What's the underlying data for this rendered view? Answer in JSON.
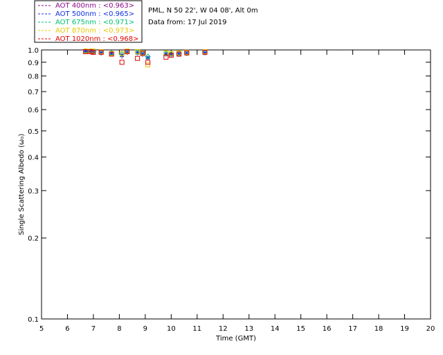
{
  "header": {
    "site": "PML, N 50 22', W 04 08', Alt 0m",
    "date": "Data from: 17 Jul 2019"
  },
  "chart_data": {
    "type": "scatter",
    "title": "",
    "xlabel": "Time (GMT)",
    "ylabel": "Single Scattering Albedo (ω₀)",
    "xlim": [
      5,
      20
    ],
    "ylim": [
      0.1,
      1.0
    ],
    "yscale": "log",
    "x_ticks": [
      5,
      6,
      7,
      8,
      9,
      10,
      11,
      12,
      13,
      14,
      15,
      16,
      17,
      18,
      19,
      20
    ],
    "y_ticks": [
      0.1,
      0.2,
      0.3,
      0.4,
      0.5,
      0.6,
      0.7,
      0.8,
      0.9,
      1.0
    ],
    "y_tick_labels": [
      "0.1",
      "0.2",
      "0.3",
      "0.4",
      "0.5",
      "0.6",
      "0.7",
      "0.8",
      "0.9",
      "1.0"
    ],
    "grid": false,
    "legend_position": "top-left",
    "series": [
      {
        "name": "AOT  400nm : <0.963>",
        "color": "#8b0a8b",
        "marker": "plus",
        "x": [
          6.7,
          6.9,
          7.0,
          7.3,
          7.7,
          8.1,
          8.3,
          8.7,
          8.9,
          9.1,
          9.8,
          10.0,
          10.3,
          10.6,
          11.3
        ],
        "y": [
          0.985,
          0.98,
          0.975,
          0.97,
          0.965,
          0.945,
          0.975,
          0.97,
          0.96,
          0.93,
          0.96,
          0.955,
          0.96,
          0.965,
          0.97
        ]
      },
      {
        "name": "AOT  500nm : <0.965>",
        "color": "#1030e0",
        "marker": "asterisk",
        "x": [
          6.7,
          6.9,
          7.0,
          7.3,
          7.7,
          8.1,
          8.3,
          8.7,
          8.9,
          9.1,
          9.8,
          10.0,
          10.3,
          10.6,
          11.3
        ],
        "y": [
          0.99,
          0.985,
          0.98,
          0.975,
          0.97,
          0.955,
          0.98,
          0.975,
          0.965,
          0.935,
          0.965,
          0.96,
          0.965,
          0.97,
          0.975
        ]
      },
      {
        "name": "AOT  675nm : <0.971>",
        "color": "#00c070",
        "marker": "diamond",
        "x": [
          6.7,
          6.9,
          7.0,
          7.3,
          7.7,
          8.1,
          8.3,
          8.7,
          8.9,
          9.1,
          9.8,
          10.0,
          10.3,
          10.6,
          11.3
        ],
        "y": [
          0.99,
          0.99,
          0.985,
          0.98,
          0.975,
          0.965,
          0.985,
          0.98,
          0.97,
          0.945,
          0.97,
          0.965,
          0.97,
          0.975,
          0.98
        ]
      },
      {
        "name": "AOT  870nm : <0.973>",
        "color": "#e8c800",
        "marker": "square",
        "x": [
          6.7,
          6.9,
          7.0,
          7.3,
          7.7,
          8.1,
          8.3,
          8.7,
          8.9,
          9.1,
          9.8,
          10.0,
          10.3,
          10.6,
          11.3
        ],
        "y": [
          0.99,
          0.99,
          0.99,
          0.985,
          0.97,
          0.97,
          0.99,
          0.985,
          0.975,
          0.88,
          0.975,
          0.97,
          0.975,
          0.98,
          0.985
        ]
      },
      {
        "name": "AOT 1020nm : <0.968>",
        "color": "#e00000",
        "marker": "square",
        "x": [
          6.7,
          6.9,
          7.0,
          7.3,
          7.7,
          8.1,
          8.3,
          8.7,
          8.9,
          9.1,
          9.8,
          10.0,
          10.3,
          10.6,
          11.3
        ],
        "y": [
          0.985,
          0.985,
          0.98,
          0.98,
          0.965,
          0.9,
          0.985,
          0.93,
          0.97,
          0.9,
          0.94,
          0.955,
          0.965,
          0.975,
          0.98
        ]
      }
    ]
  }
}
